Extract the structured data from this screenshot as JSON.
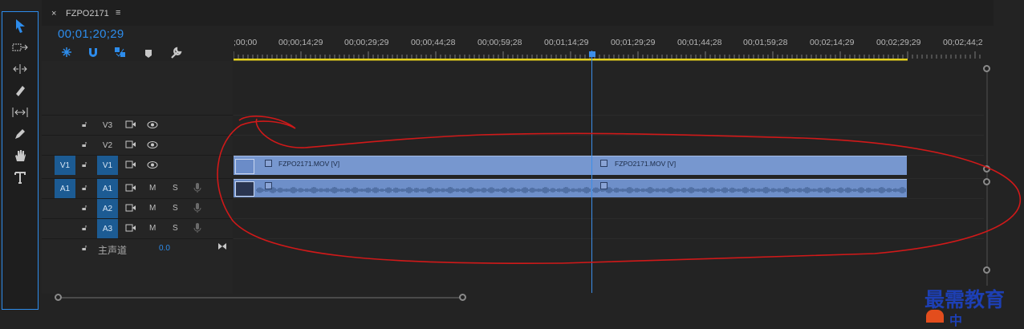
{
  "sequence": {
    "tab_title": "FZPO2171",
    "timecode": "00;01;20;29"
  },
  "ruler": {
    "labels": [
      ";00;00",
      "00;00;14;29",
      "00;00;29;29",
      "00;00;44;28",
      "00;00;59;28",
      "00;01;14;29",
      "00;01;29;29",
      "00;01;44;28",
      "00;01;59;28",
      "00;02;14;29",
      "00;02;29;29",
      "00;02;44;2"
    ]
  },
  "tracks": {
    "v3": {
      "label": "V3"
    },
    "v2": {
      "label": "V2"
    },
    "v1": {
      "source": "V1",
      "label": "V1"
    },
    "a1": {
      "source": "A1",
      "label": "A1",
      "mute": "M",
      "solo": "S"
    },
    "a2": {
      "label": "A2",
      "mute": "M",
      "solo": "S"
    },
    "a3": {
      "label": "A3",
      "mute": "M",
      "solo": "S"
    },
    "master": {
      "label": "主声道",
      "value": "0.0"
    }
  },
  "clips": {
    "video1": "FZPO2171.MOV [V]",
    "video2": "FZPO2171.MOV [V]"
  },
  "icons": {
    "selection": "selection-tool-icon",
    "track_select": "track-select-icon",
    "ripple": "ripple-edit-icon",
    "razor": "razor-icon",
    "slip": "slip-icon",
    "pen": "pen-icon",
    "hand": "hand-icon",
    "type": "type-icon"
  },
  "colors": {
    "accent": "#2d8ceb",
    "clip": "#7797cf",
    "annotation": "#d01919",
    "work_area": "#e6d21e"
  },
  "watermark": {
    "text": "最需教育",
    "sub": "中"
  }
}
